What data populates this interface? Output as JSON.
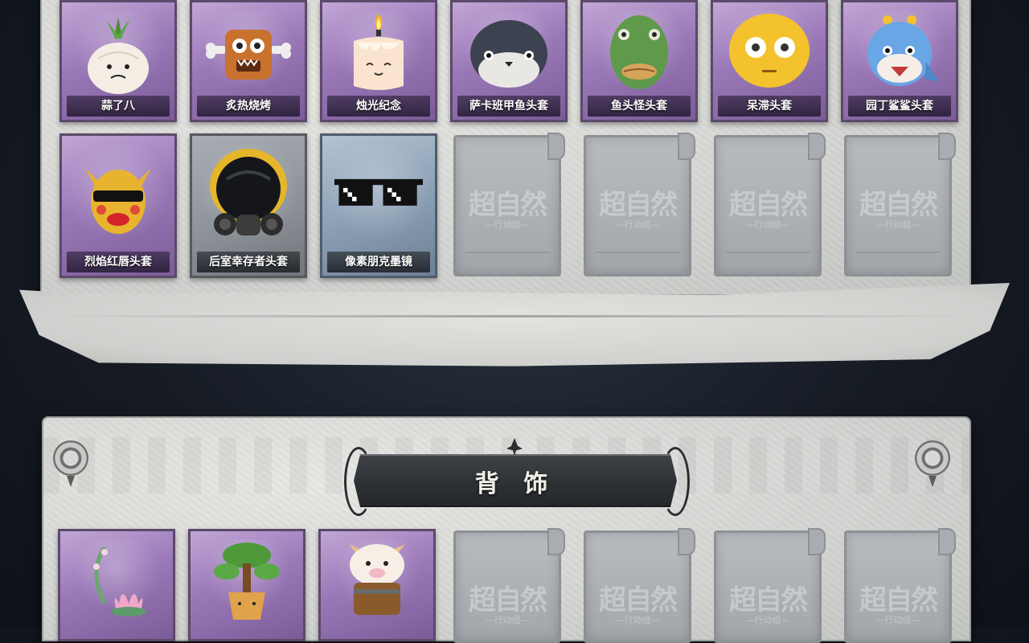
{
  "sections": [
    {
      "items": [
        {
          "name": "蒜了八",
          "art": "garlic-face-icon",
          "rarity": "purple"
        },
        {
          "name": "炙热烧烤",
          "art": "grilled-meat-face-icon",
          "rarity": "purple"
        },
        {
          "name": "烛光纪念",
          "art": "candle-face-icon",
          "rarity": "purple"
        },
        {
          "name": "萨卡班甲鱼头套",
          "art": "sacabambaspis-fish-icon",
          "rarity": "purple"
        },
        {
          "name": "鱼头怪头套",
          "art": "green-fish-head-icon",
          "rarity": "purple"
        },
        {
          "name": "呆滞头套",
          "art": "yellow-blank-face-icon",
          "rarity": "purple"
        },
        {
          "name": "园丁鲨鲨头套",
          "art": "shark-hat-icon",
          "rarity": "purple"
        },
        {
          "name": "烈焰红唇头套",
          "art": "yellow-pikachu-mask-icon",
          "rarity": "purple"
        },
        {
          "name": "后室幸存者头套",
          "art": "gas-mask-helmet-icon",
          "rarity": "gray"
        },
        {
          "name": "像素朋克墨镜",
          "art": "pixel-sunglasses-icon",
          "rarity": "blue"
        }
      ]
    },
    {
      "title": "背 饰",
      "items": [
        {
          "name": "",
          "art": "lotus-vine-icon",
          "rarity": "purple"
        },
        {
          "name": "",
          "art": "bonsai-pot-icon",
          "rarity": "purple"
        },
        {
          "name": "",
          "art": "cow-bucket-icon",
          "rarity": "purple"
        }
      ]
    }
  ],
  "placeholder": {
    "logo": "超自然",
    "sub": "—行动组—"
  }
}
